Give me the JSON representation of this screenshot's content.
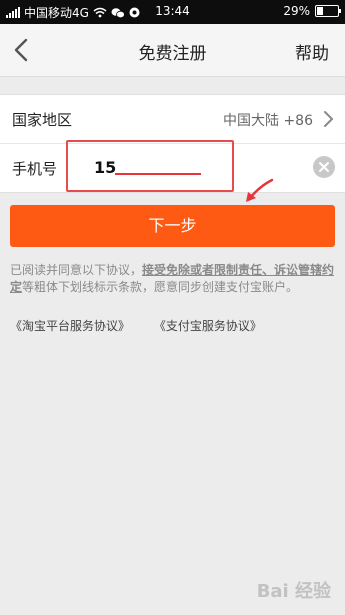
{
  "status_bar": {
    "carrier": "中国移动4G",
    "time": "13:44",
    "battery_percent": "29%",
    "battery_level": 0.29
  },
  "header": {
    "title": "免费注册",
    "help": "帮助",
    "back_icon": "chevron-left-icon"
  },
  "form": {
    "region_label": "国家地区",
    "region_value": "中国大陆 +86",
    "phone_label": "手机号",
    "phone_value": "15"
  },
  "next_button": "下一步",
  "agreement": {
    "text_1": "已阅读并同意以下协议，",
    "text_bold": "接受免除或者限制责任、诉讼管辖约定",
    "text_2": "等粗体下划线标示条款，愿意同步创建支付宝账户。",
    "link_1": "《淘宝平台服务协议》",
    "link_2": "《支付宝服务协议》"
  },
  "watermark": "Bai  经验",
  "colors": {
    "accent": "#ff5a14",
    "annotation": "#e84b4b"
  }
}
